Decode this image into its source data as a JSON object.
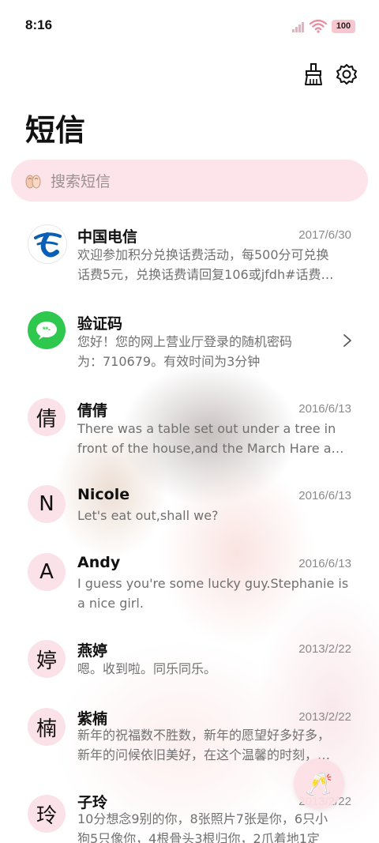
{
  "status_bar": {
    "time": "8:16",
    "battery": "100",
    "icons": [
      "signal-icon",
      "wifi-icon",
      "battery-icon"
    ]
  },
  "toolbar": {
    "icons": [
      "clean-brush-icon",
      "settings-gear-icon"
    ]
  },
  "page": {
    "title": "短信"
  },
  "search": {
    "placeholder": "搜索短信",
    "icon": "search-icon"
  },
  "messages": [
    {
      "avatar_text": "",
      "avatar_icon": "china-telecom-logo",
      "sender": "中国电信",
      "date": "2017/6/30",
      "preview_lines": [
        "欢迎参加积分兑换话费活动，每500分可兑换",
        "话费5元，兑换话费请回复106或jfdh#话费…"
      ]
    },
    {
      "avatar_text": "",
      "avatar_icon": "message-bubble-icon",
      "sender": "验证码",
      "date": "",
      "preview_lines": [
        "您好！您的网上营业厅登录的随机密码",
        "为：710679。有效时间为3分钟"
      ]
    },
    {
      "avatar_text": "倩",
      "sender": "倩倩",
      "date": "2016/6/13",
      "preview_lines": [
        "There was a table set out under a tree in",
        "front of the house,and the March Hare an…"
      ]
    },
    {
      "avatar_text": "N",
      "sender": "Nicole",
      "date": "2016/6/13",
      "preview_lines": [
        "Let's eat out,shall we?"
      ]
    },
    {
      "avatar_text": "A",
      "sender": "Andy",
      "date": "2016/6/13",
      "preview_lines": [
        "I guess you're some lucky guy.Stephanie is",
        "a nice girl."
      ]
    },
    {
      "avatar_text": "婷",
      "sender": "燕婷",
      "date": "2013/2/22",
      "preview_lines": [
        "嗯。收到啦。同乐同乐。"
      ]
    },
    {
      "avatar_text": "楠",
      "sender": "紫楠",
      "date": "2013/2/22",
      "preview_lines": [
        "新年的祝福数不胜数，新年的愿望好多好多，",
        "新年的问候依旧美好，在这个温馨的时刻，…"
      ]
    },
    {
      "avatar_text": "玲",
      "sender": "子玲",
      "date": "2013/2/22",
      "preview_lines": [
        "10分想念9别的你，8张照片7张是你，6只小",
        "狗5只像你，4根骨头3根归你，2爪着地1定"
      ]
    }
  ],
  "fab": {
    "icon": "cheers-glasses-icon",
    "glyph": "🥂"
  },
  "colors": {
    "accent_pink": "#fde4ea",
    "avatar_pink": "#fbe1e8",
    "telecom_blue": "#0a5eb5",
    "sms_green": "#2ec84f"
  }
}
